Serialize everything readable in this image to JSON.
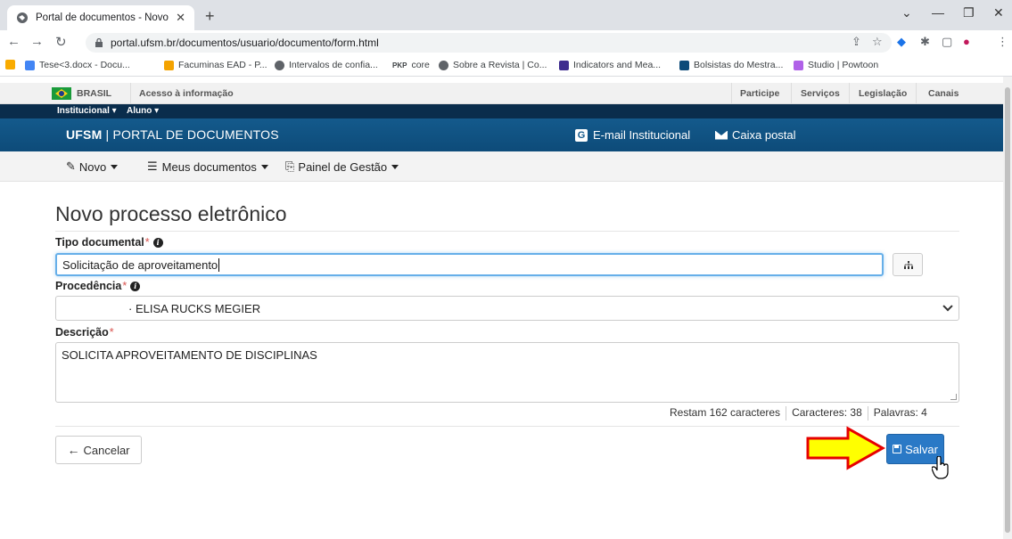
{
  "browser": {
    "tab_title": "Portal de documentos - Novo pr",
    "url": "portal.ufsm.br/documentos/usuario/documento/form.html",
    "bookmarks": [
      "Tese<3.docx - Docu...",
      "Facuminas EAD - P...",
      "Intervalos de confia...",
      "core",
      "Sobre a Revista | Co...",
      "Indicators and Mea...",
      "Bolsistas do Mestra...",
      "Studio | Powtoon"
    ],
    "pkp_label": "PKP"
  },
  "govbar": {
    "brasil": "BRASIL",
    "acesso": "Acesso à informação",
    "links": [
      "Participe",
      "Serviços",
      "Legislação",
      "Canais"
    ]
  },
  "instbar": {
    "institucional": "Institucional ▾",
    "aluno": "Aluno ▾"
  },
  "header": {
    "brand_bold": "UFSM",
    "brand_sep": " | ",
    "brand_rest": "PORTAL DE DOCUMENTOS",
    "email": "E-mail Institucional",
    "caixa": "Caixa postal",
    "g_letter": "G"
  },
  "appnav": {
    "novo": "Novo",
    "meus": "Meus documentos",
    "painel": "Painel de Gestão"
  },
  "form": {
    "heading": "Novo processo eletrônico",
    "tipo_label": "Tipo documental",
    "tipo_value": "Solicitação de aproveitamento",
    "procedencia_label": "Procedência",
    "procedencia_value": "· ELISA RUCKS MEGIER",
    "descricao_label": "Descrição",
    "descricao_value": "SOLICITA APROVEITAMENTO DE DISCIPLINAS",
    "required_mark": "*",
    "info_glyph": "i",
    "counter": {
      "restam": "Restam 162 caracteres",
      "caracteres": "Caracteres: 38",
      "palavras": "Palavras: 4"
    },
    "cancel_label": "Cancelar",
    "save_label": "Salvar"
  },
  "colors": {
    "header_bg": "#145a8c",
    "inst_bg": "#0a2d4c",
    "save_btn": "#2a79c6",
    "arrow_fill": "#ffff00",
    "arrow_stroke": "#e60000"
  }
}
